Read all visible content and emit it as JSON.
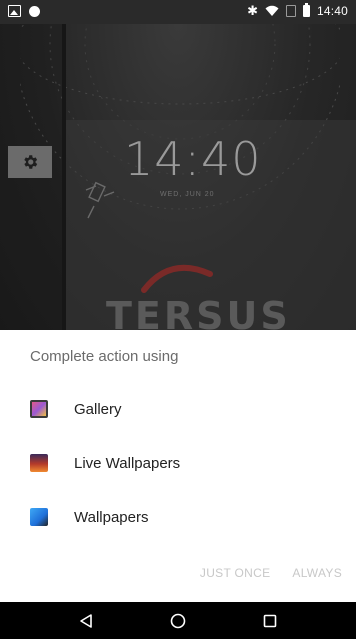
{
  "status_bar": {
    "time": "14:40",
    "icons": [
      "image-icon",
      "circle-icon",
      "bluetooth-icon",
      "wifi-icon",
      "no-sim-icon",
      "battery-icon"
    ]
  },
  "lockscreen": {
    "clock": "14:40",
    "date": "WED, JUN 20",
    "brand": "TERSUS"
  },
  "dialog": {
    "title": "Complete action using",
    "options": [
      {
        "label": "Gallery",
        "icon": "gallery-icon"
      },
      {
        "label": "Live Wallpapers",
        "icon": "live-wallpapers-icon"
      },
      {
        "label": "Wallpapers",
        "icon": "wallpapers-icon"
      }
    ],
    "just_once": "JUST ONCE",
    "always": "ALWAYS"
  },
  "nav": {
    "back": "back-icon",
    "home": "home-icon",
    "recents": "recents-icon"
  }
}
